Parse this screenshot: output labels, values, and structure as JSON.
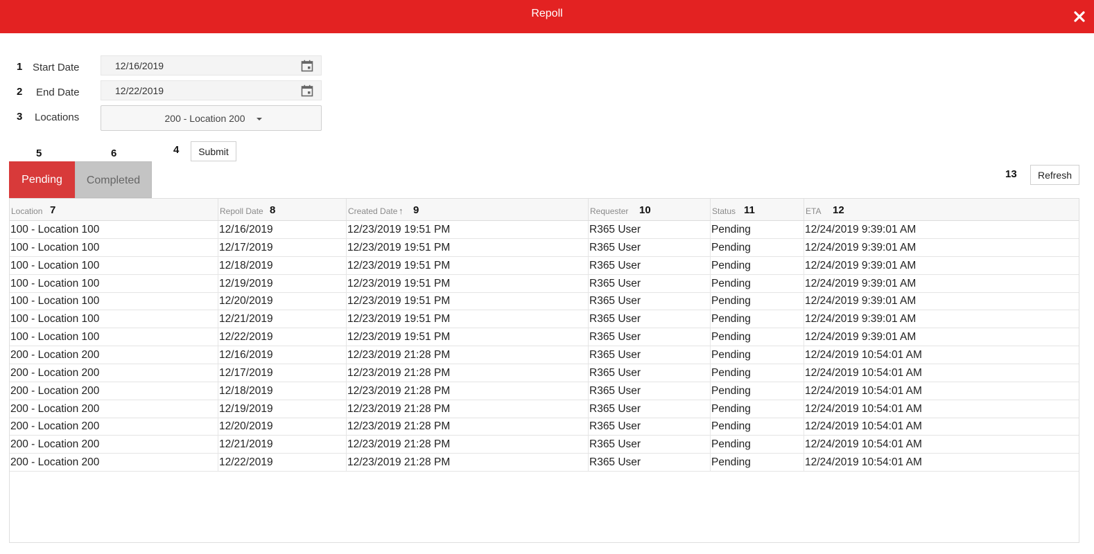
{
  "dialog": {
    "title": "Repoll",
    "close_icon": "close-icon",
    "accent_color": "#e32222"
  },
  "form": {
    "start_date": {
      "number": "1",
      "label": "Start Date",
      "value": "12/16/2019",
      "icon": "calendar-icon"
    },
    "end_date": {
      "number": "2",
      "label": "End Date",
      "value": "12/22/2019",
      "icon": "calendar-icon"
    },
    "locations": {
      "number": "3",
      "label": "Locations",
      "value": "200 - Location 200",
      "icon": "caret-down-icon"
    },
    "submit": {
      "number": "4",
      "label": "Submit"
    }
  },
  "tabs": [
    {
      "number": "5",
      "label": "Pending",
      "active": true
    },
    {
      "number": "6",
      "label": "Completed",
      "active": false
    }
  ],
  "refresh": {
    "number": "13",
    "label": "Refresh"
  },
  "table": {
    "columns": [
      {
        "label": "Location",
        "number": "7"
      },
      {
        "label": "Repoll Date",
        "number": "8"
      },
      {
        "label": "Created Date",
        "number": "9",
        "sort": "↑"
      },
      {
        "label": "Requester",
        "number": "10"
      },
      {
        "label": "Status",
        "number": "11"
      },
      {
        "label": "ETA",
        "number": "12"
      }
    ],
    "rows": [
      [
        "100 - Location 100",
        "12/16/2019",
        "12/23/2019 19:51 PM",
        "R365 User",
        "Pending",
        "12/24/2019 9:39:01 AM"
      ],
      [
        "100 - Location 100",
        "12/17/2019",
        "12/23/2019 19:51 PM",
        "R365 User",
        "Pending",
        "12/24/2019 9:39:01 AM"
      ],
      [
        "100 - Location 100",
        "12/18/2019",
        "12/23/2019 19:51 PM",
        "R365 User",
        "Pending",
        "12/24/2019 9:39:01 AM"
      ],
      [
        "100 - Location 100",
        "12/19/2019",
        "12/23/2019 19:51 PM",
        "R365 User",
        "Pending",
        "12/24/2019 9:39:01 AM"
      ],
      [
        "100 - Location 100",
        "12/20/2019",
        "12/23/2019 19:51 PM",
        "R365 User",
        "Pending",
        "12/24/2019 9:39:01 AM"
      ],
      [
        "100 - Location 100",
        "12/21/2019",
        "12/23/2019 19:51 PM",
        "R365 User",
        "Pending",
        "12/24/2019 9:39:01 AM"
      ],
      [
        "100 - Location 100",
        "12/22/2019",
        "12/23/2019 19:51 PM",
        "R365 User",
        "Pending",
        "12/24/2019 9:39:01 AM"
      ],
      [
        "200 - Location 200",
        "12/16/2019",
        "12/23/2019 21:28 PM",
        "R365 User",
        "Pending",
        "12/24/2019 10:54:01 AM"
      ],
      [
        "200 - Location 200",
        "12/17/2019",
        "12/23/2019 21:28 PM",
        "R365 User",
        "Pending",
        "12/24/2019 10:54:01 AM"
      ],
      [
        "200 - Location 200",
        "12/18/2019",
        "12/23/2019 21:28 PM",
        "R365 User",
        "Pending",
        "12/24/2019 10:54:01 AM"
      ],
      [
        "200 - Location 200",
        "12/19/2019",
        "12/23/2019 21:28 PM",
        "R365 User",
        "Pending",
        "12/24/2019 10:54:01 AM"
      ],
      [
        "200 - Location 200",
        "12/20/2019",
        "12/23/2019 21:28 PM",
        "R365 User",
        "Pending",
        "12/24/2019 10:54:01 AM"
      ],
      [
        "200 - Location 200",
        "12/21/2019",
        "12/23/2019 21:28 PM",
        "R365 User",
        "Pending",
        "12/24/2019 10:54:01 AM"
      ],
      [
        "200 - Location 200",
        "12/22/2019",
        "12/23/2019 21:28 PM",
        "R365 User",
        "Pending",
        "12/24/2019 10:54:01 AM"
      ]
    ]
  }
}
